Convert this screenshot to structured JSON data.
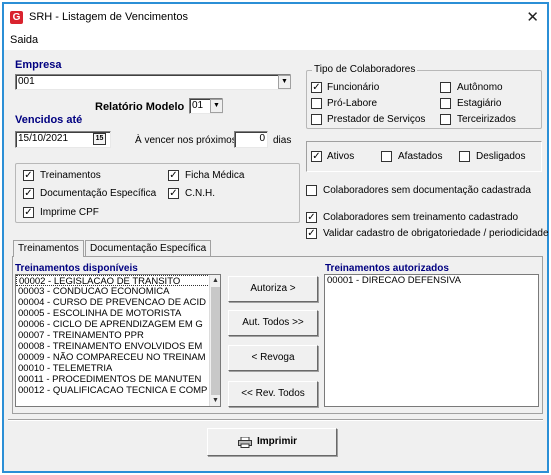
{
  "window": {
    "title": "SRH - Listagem de Vencimentos",
    "app_icon": "G",
    "close_glyph": "✕"
  },
  "menu": {
    "items": [
      "Saida"
    ]
  },
  "empresa": {
    "label": "Empresa",
    "value": "001"
  },
  "relatorio_modelo": {
    "label": "Relatório Modelo",
    "value": "01"
  },
  "vencidos": {
    "label": "Vencidos até",
    "value": "15/10/2021",
    "calendar_icon": "15"
  },
  "a_vencer": {
    "label": "À vencer nos próximos",
    "value": "0",
    "unit": "dias"
  },
  "opcoes": {
    "treinamentos": {
      "label": "Treinamentos",
      "checked": true
    },
    "documentacao": {
      "label": "Documentação Específica",
      "checked": true
    },
    "imprime_cpf": {
      "label": "Imprime CPF",
      "checked": true
    },
    "ficha_medica": {
      "label": "Ficha Médica",
      "checked": true
    },
    "cnh": {
      "label": "C.N.H.",
      "checked": true
    }
  },
  "tipo_colaboradores": {
    "legend": "Tipo de Colaboradores",
    "items": [
      {
        "label": "Funcionário",
        "checked": true
      },
      {
        "label": "Autônomo",
        "checked": false
      },
      {
        "label": "Pró-Labore",
        "checked": false
      },
      {
        "label": "Estagiário",
        "checked": false
      },
      {
        "label": "Prestador de Serviços",
        "checked": false
      },
      {
        "label": "Terceirizados",
        "checked": false
      }
    ]
  },
  "situacao": {
    "ativos": {
      "label": "Ativos",
      "checked": true
    },
    "afastados": {
      "label": "Afastados",
      "checked": false
    },
    "desligados": {
      "label": "Desligados",
      "checked": false
    }
  },
  "filtros": {
    "sem_documentacao": {
      "label": "Colaboradores sem documentação cadastrada",
      "checked": false
    },
    "sem_treinamento": {
      "label": "Colaboradores sem treinamento cadastrado",
      "checked": true
    },
    "validar_cadastro": {
      "label": "Validar cadastro de obrigatoriedade / periodicidade",
      "checked": true
    }
  },
  "tabs": {
    "treinamentos": "Treinamentos",
    "documentacao": "Documentação Específica"
  },
  "disponiveis": {
    "header": "Treinamentos disponíveis",
    "items": [
      "00002 - LEGISLACAO DE TRANSITO",
      "00003 - CONDUCAO ECONOMICA",
      "00004 - CURSO DE PREVENCAO DE ACID",
      "00005 - ESCOLINHA DE MOTORISTA",
      "00006 - CICLO DE APRENDIZAGEM EM G",
      "00007 - TREINAMENTO PPR",
      "00008 - TREINAMENTO ENVOLVIDOS EM",
      "00009 - NÃO COMPARECEU NO TREINAM",
      "00010 - TELEMETRIA",
      "00011 - PROCEDIMENTOS DE MANUTEN",
      "00012 - QUALIFICACAO TECNICA E COMP"
    ]
  },
  "autorizados": {
    "header": "Treinamentos autorizados",
    "items": [
      "00001 - DIRECAO DEFENSIVA"
    ]
  },
  "buttons": {
    "autoriza": "Autoriza >",
    "aut_todos": "Aut. Todos >>",
    "revoga": "< Revoga",
    "rev_todos": "<< Rev. Todos",
    "imprimir": "Imprimir"
  }
}
